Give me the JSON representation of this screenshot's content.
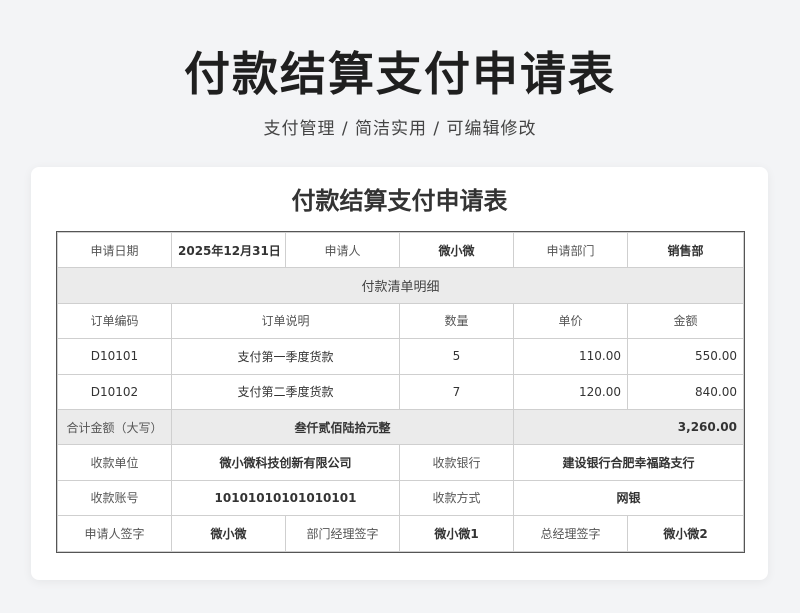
{
  "hero": {
    "title": "付款结算支付申请表",
    "subtitle": "支付管理 / 简洁实用 / 可编辑修改"
  },
  "doc": {
    "title": "付款结算支付申请表",
    "header_row": {
      "date_label": "申请日期",
      "date_value": "2025年12月31日",
      "applicant_label": "申请人",
      "applicant_value": "微小微",
      "dept_label": "申请部门",
      "dept_value": "销售部"
    },
    "section_title": "付款清单明细",
    "columns": [
      "订单编码",
      "订单说明",
      "数量",
      "单价",
      "金额"
    ],
    "rows": [
      {
        "code": "D10101",
        "desc": "支付第一季度货款",
        "qty": "5",
        "price": "110.00",
        "amount": "550.00"
      },
      {
        "code": "D10102",
        "desc": "支付第二季度货款",
        "qty": "7",
        "price": "120.00",
        "amount": "840.00"
      }
    ],
    "total": {
      "label": "合计金额（大写）",
      "words": "叁仟贰佰陆拾元整",
      "amount": "3,260.00"
    },
    "payee": {
      "unit_label": "收款单位",
      "unit_value": "微小微科技创新有限公司",
      "bank_label": "收款银行",
      "bank_value": "建设银行合肥幸福路支行"
    },
    "account": {
      "account_label": "收款账号",
      "account_value": "10101010101010101",
      "method_label": "收款方式",
      "method_value": "网银"
    },
    "signatures": {
      "applicant_label": "申请人签字",
      "applicant_value": "微小微",
      "manager_label": "部门经理签字",
      "manager_value": "微小微1",
      "gm_label": "总经理签字",
      "gm_value": "微小微2"
    }
  }
}
